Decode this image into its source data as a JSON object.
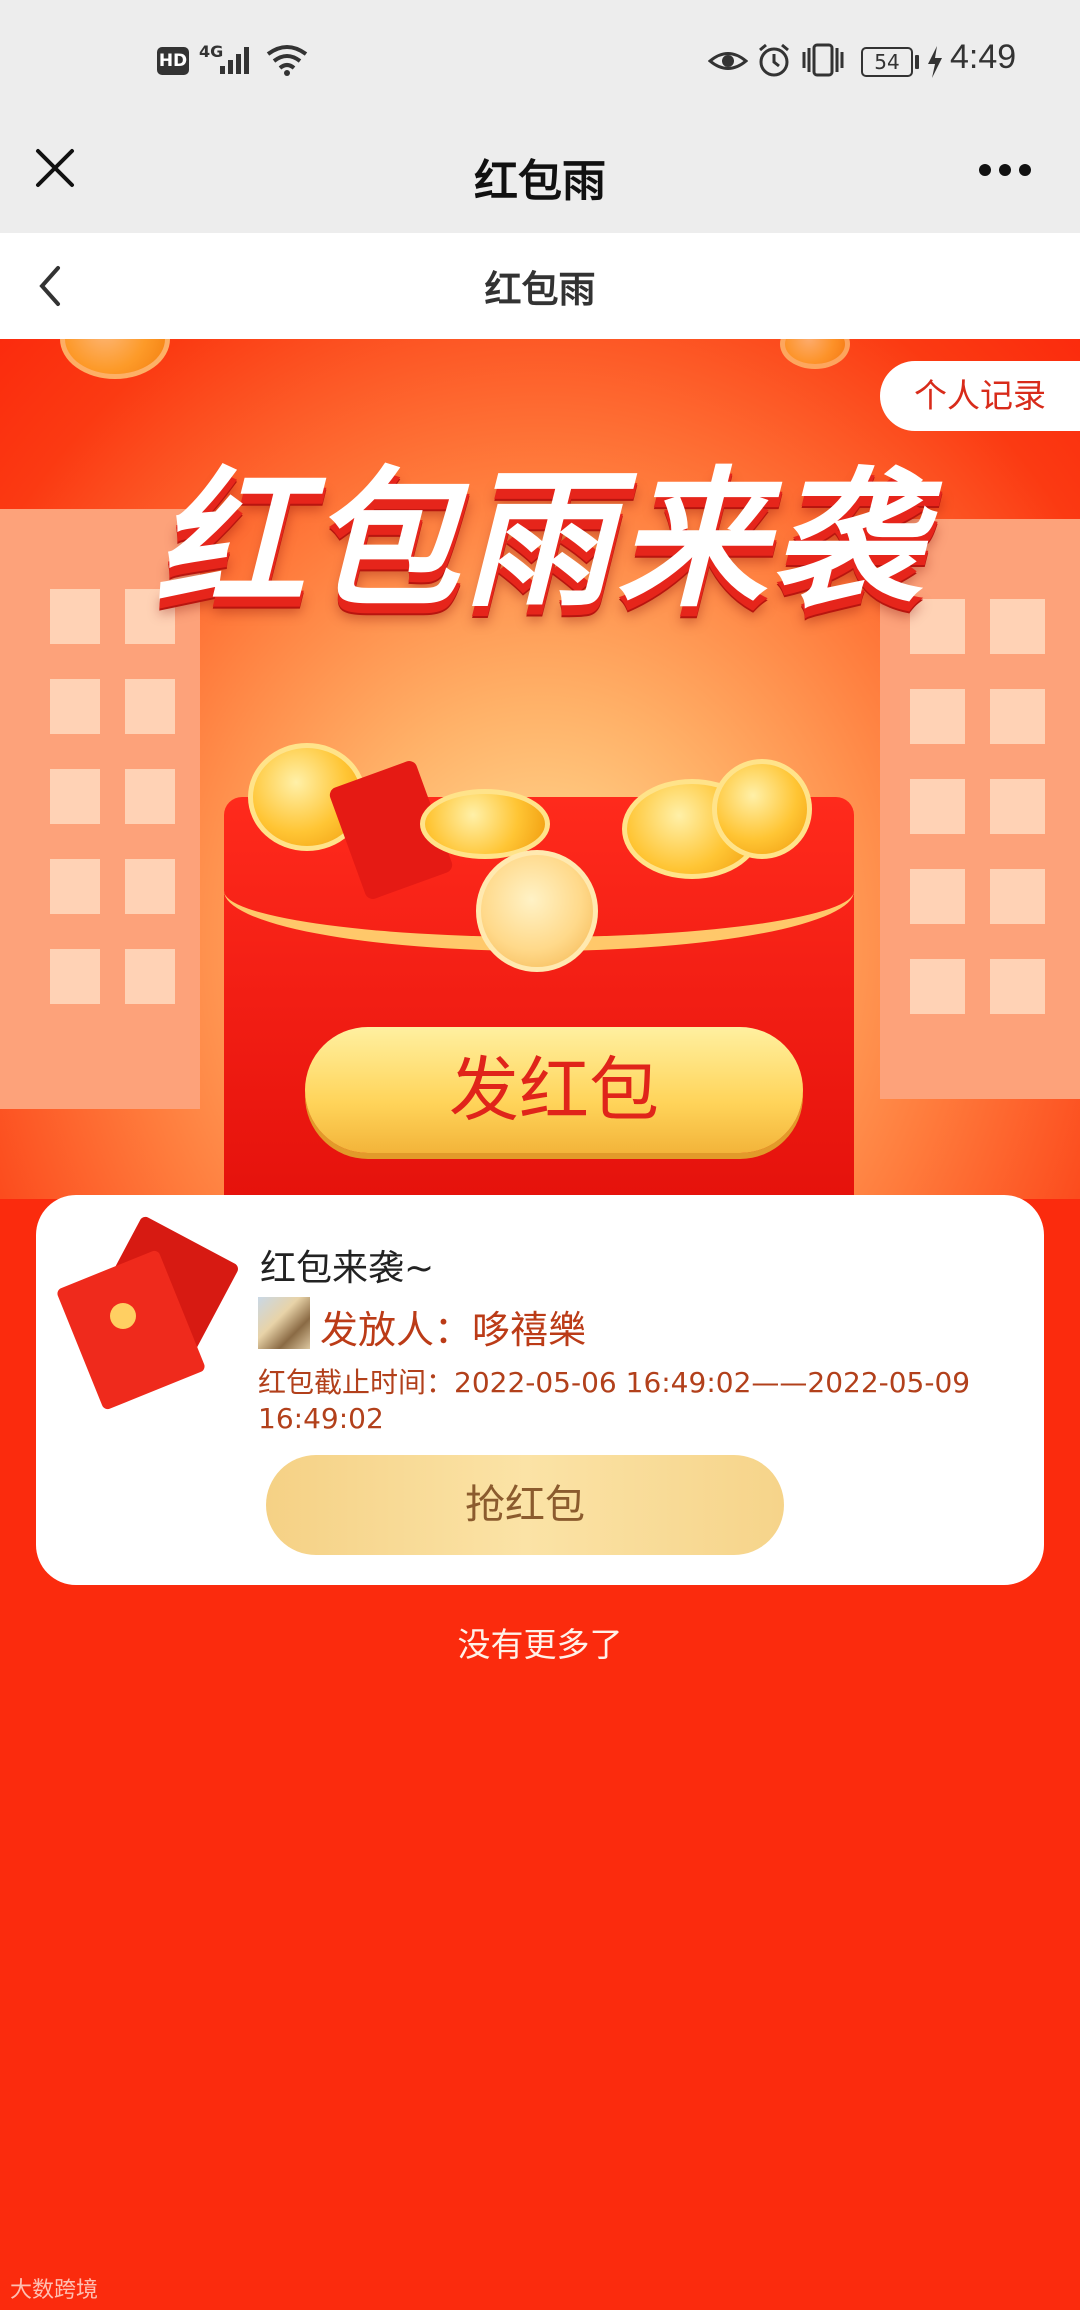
{
  "status_bar": {
    "hd": "HD",
    "network": "4G",
    "battery": "54",
    "time": "4:49"
  },
  "wechat_header": {
    "title": "红包雨",
    "close_icon": "close-icon",
    "more_icon": "more-icon"
  },
  "page_nav": {
    "title": "红包雨",
    "back_icon": "chevron-left-icon"
  },
  "banner": {
    "headline": "红包雨来袭",
    "record_button": "个人记录",
    "send_button": "发红包"
  },
  "card": {
    "title": "红包来袭~",
    "sender": "发放人：哆禧樂",
    "deadline": "红包截止时间：2022-05-06 16:49:02——2022-05-09 16:49:02",
    "grab_button": "抢红包"
  },
  "footer": {
    "no_more": "没有更多了"
  },
  "watermark": "大数跨境",
  "colors": {
    "page_bg": "#fb2b0d",
    "accent_red": "#e0241a",
    "gold": "#ffd45a"
  }
}
